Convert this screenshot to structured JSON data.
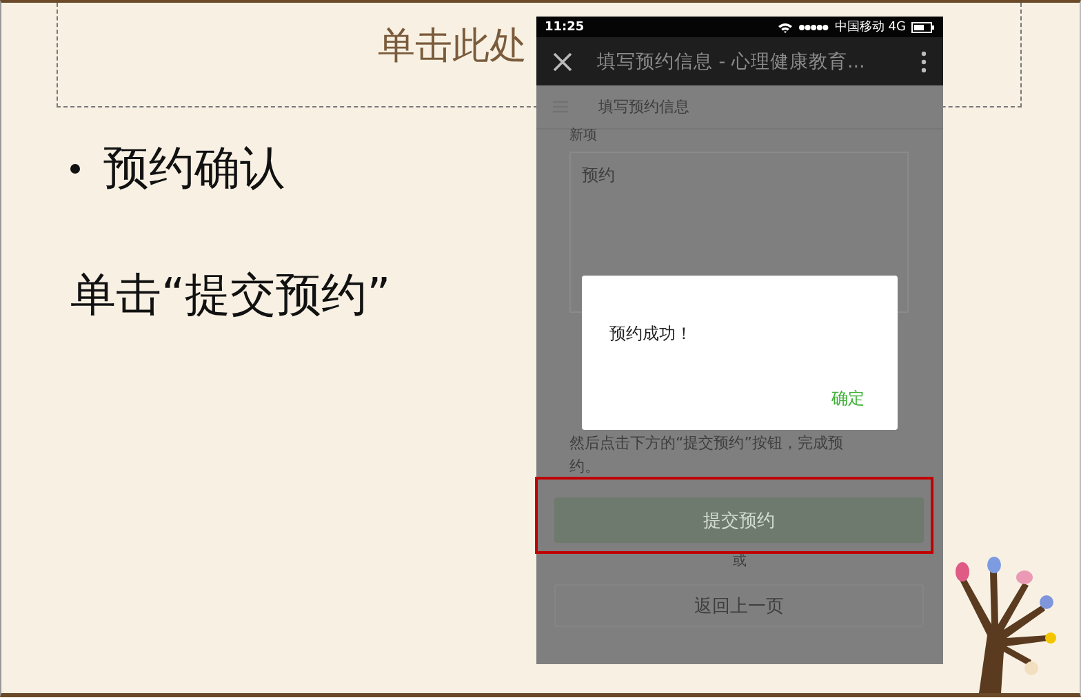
{
  "slide": {
    "title_placeholder": "单击此处",
    "bullets": [
      "预约确认"
    ],
    "body": "单击“提交预约”"
  },
  "phone": {
    "status_bar": {
      "time": "11:25",
      "carrier": "中国移动 4G"
    },
    "app_bar": {
      "title": "填写预约信息 - 心理健康教育..."
    },
    "page": {
      "header": "填写预约信息",
      "field_label": "新项",
      "field_placeholder": "预约",
      "note_lines": [
        "然后点击下方的“提交预约”按钮，完成预",
        "约。"
      ],
      "submit_button": "提交预约",
      "separator": "或",
      "back_button": "返回上一页"
    },
    "dialog": {
      "message": "预约成功！",
      "confirm": "确定"
    }
  },
  "highlight_submit": true
}
